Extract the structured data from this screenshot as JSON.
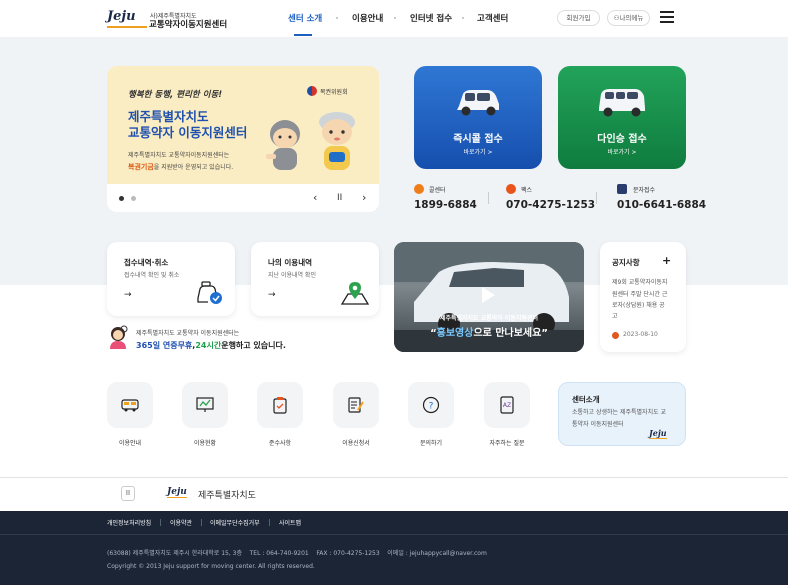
{
  "header": {
    "logo_text": "Jeju",
    "logo_sub": "사)제주특별자치도",
    "logo_main": "교통약자이동지원센터",
    "nav": [
      "센터 소개",
      "이용안내",
      "인터넷 접수",
      "고객센터"
    ],
    "join_label": "회원가입",
    "mymenu_label": "나의메뉴"
  },
  "hero": {
    "slogan": "행복한 동행, 편리한 이동!",
    "title1": "제주특별자치도",
    "title2": "교통약자 이동지원센터",
    "desc1": "제주특별자치도 교통약자이동지원센터는",
    "desc2_bold": "복권기금",
    "desc2_rest": "을 지원받아 운영되고 있습니다.",
    "ministry": "복권위원회"
  },
  "reception": {
    "call": {
      "title": "즉시콜 접수",
      "go": "바로가기 >"
    },
    "multi": {
      "title": "다인승 접수",
      "go": "바로가기 >"
    }
  },
  "contacts": [
    {
      "label": "콜센터",
      "number": "1899-6884",
      "color": "#ef7d1a"
    },
    {
      "label": "팩스",
      "number": "070-4275-1253",
      "color": "#e8541c"
    },
    {
      "label": "문자접수",
      "number": "010-6641-6884",
      "color": "#2a3b6d"
    }
  ],
  "quick": [
    {
      "title": "접수내역·취소",
      "sub": "접수내역 확인 및 취소",
      "arrow": "→"
    },
    {
      "title": "나의 이용내역",
      "sub": "지난 이용내역 확인",
      "arrow": "→"
    }
  ],
  "video": {
    "caption1": "제주특별자치도 교통약자 이동지원센터",
    "caption2_highlight": "홍보영상",
    "caption2_open": "“",
    "caption2_rest": "으로 만나보세요”"
  },
  "notice": {
    "title": "공지사항",
    "plus": "+",
    "lines": [
      "제9회 교통약자이동지",
      "원센터 주말 단시간 근",
      "로자(상담원) 채용 공",
      "고"
    ],
    "date": "2023-08-10"
  },
  "info": {
    "line1": "제주특별자치도 교통약자 이동지원센터는",
    "line2_a": "365일 연중무휴",
    "line2_b": ",",
    "line2_c": "24시간",
    "line2_d": "운행하고 있습니다."
  },
  "menu": [
    "이용안내",
    "이용현황",
    "준수사항",
    "이용신청서",
    "문의하기",
    "자주하는 질문"
  ],
  "center_intro": {
    "title": "센터소개",
    "desc1": "소통하고 상생하는 제주특별자치도 교",
    "desc2": "통약자 이동지원센터",
    "logo": "Jeju"
  },
  "footer": {
    "pause": "II",
    "logo": "Jeju",
    "org": "제주특별자치도",
    "links": [
      "개인정보처리방침",
      "이용약관",
      "이메일무단수집거부",
      "사이트맵"
    ],
    "address": "(63088) 제주특별자치도 제주시 한라대학로 15, 3층    TEL : 064-740-9201    FAX : 070-4275-1253    이메일 : jejuhappycall@naver.com",
    "copyright": "Copyright © 2013 Jeju support for moving center. All rights reserved."
  }
}
